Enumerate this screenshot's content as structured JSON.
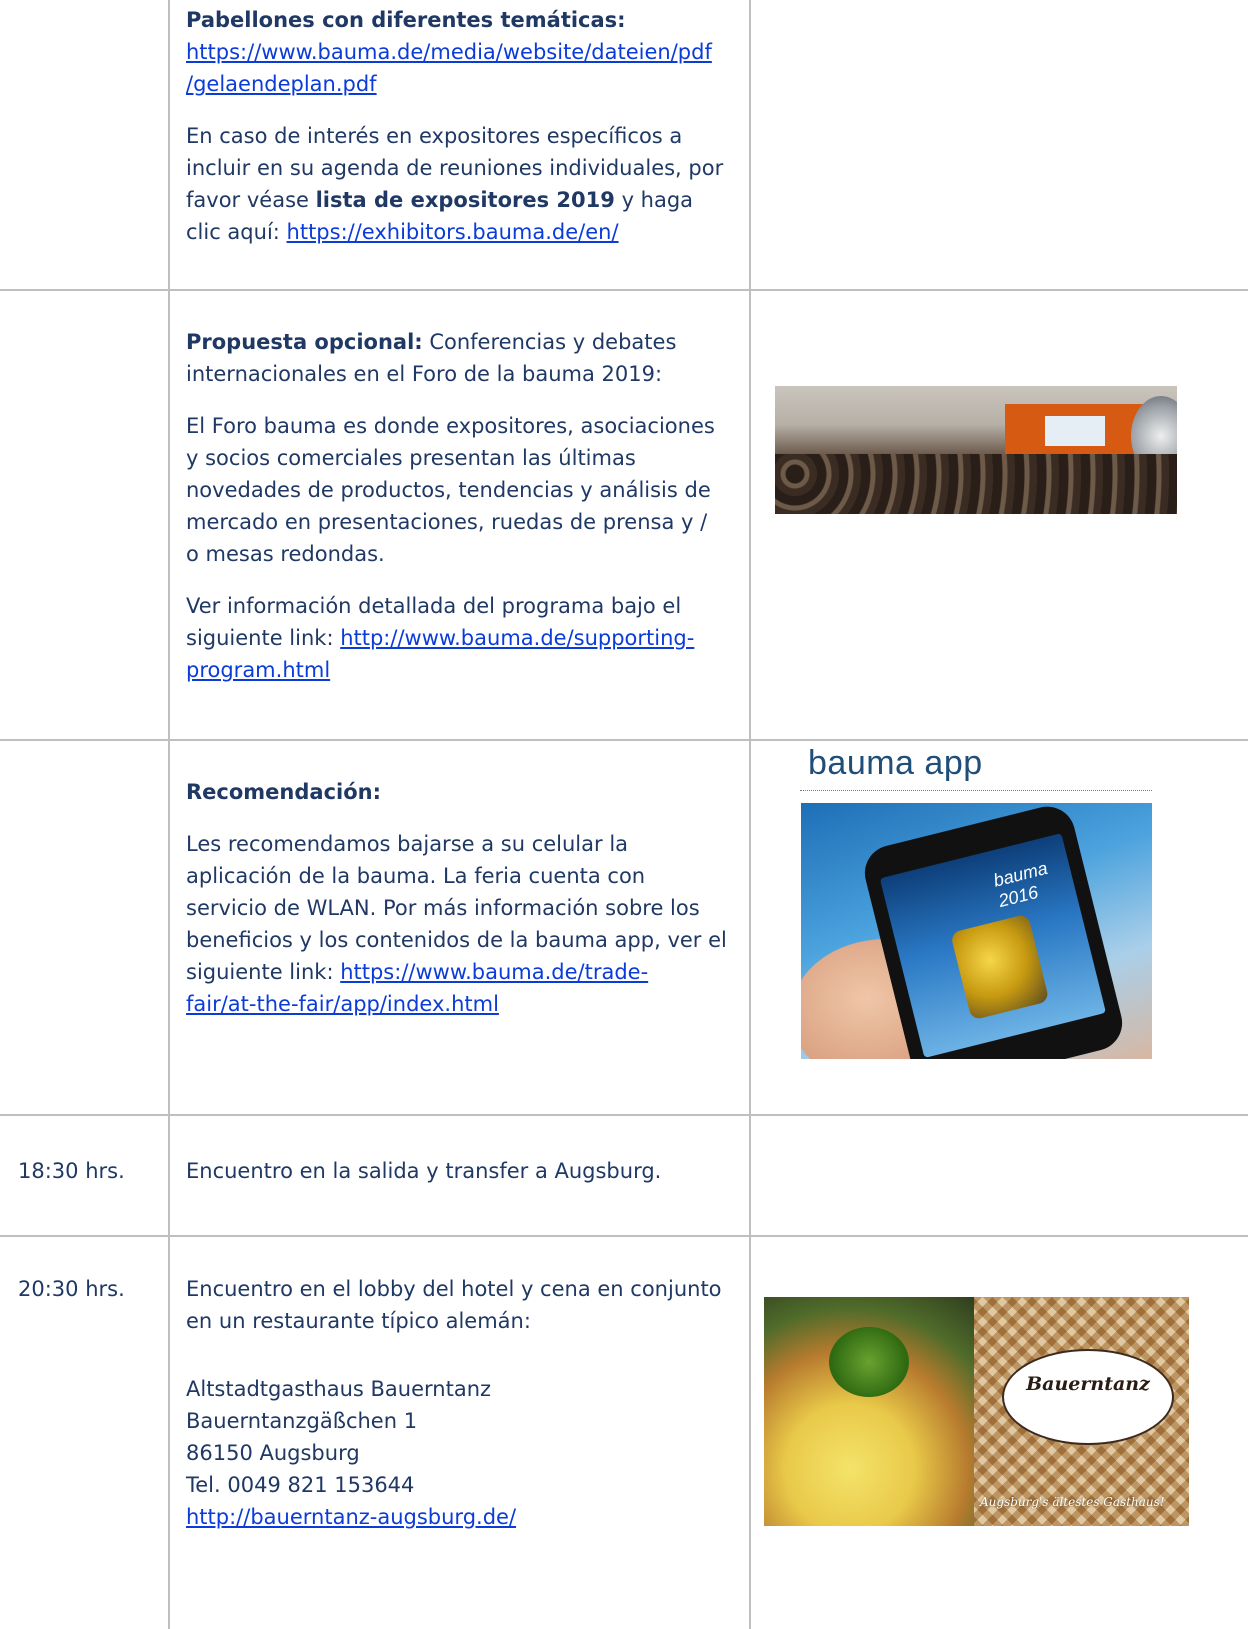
{
  "rows": {
    "row1": {
      "heading": "Pabellones con diferentes temáticas:",
      "plan_link_line1": "https://www.bauma.de/media/website/dateien/pdf",
      "plan_link_line2": "/gelaendeplan.pdf",
      "interest_l1": "En caso de interés en expositores específicos a",
      "interest_l2": "incluir en su agenda de reuniones individuales, por",
      "interest_l3_pre": "favor véase ",
      "interest_l3_bold": "lista de expositores 2019",
      "interest_l3_post": " y haga",
      "interest_l4_pre": "clic aquí: ",
      "exhibitors_link": "https://exhibitors.bauma.de/en/"
    },
    "row2": {
      "label": "Propuesta opcional:",
      "intro_l1_rest": " Conferencias y debates",
      "intro_l2": "internacionales en el Foro de la bauma 2019:",
      "desc_l1": "El Foro bauma es donde expositores, asociaciones",
      "desc_l2": "y socios comerciales presentan las últimas",
      "desc_l3": "novedades de productos, tendencias y análisis de",
      "desc_l4": "mercado en presentaciones, ruedas de prensa y /",
      "desc_l5": "o mesas redondas.",
      "program_l1": "Ver información detallada del programa bajo el",
      "program_l2_pre": "siguiente link: ",
      "program_link_l1": "http://www.bauma.de/supporting-",
      "program_link_l2": "program.html"
    },
    "row3": {
      "heading": "Recomendación:",
      "text_l1": "Les recomendamos bajarse a su celular la",
      "text_l2": "aplicación de la bauma. La feria cuenta con",
      "text_l3": "servicio de WLAN. Por más información sobre los",
      "text_l4": "beneficios y los contenidos de la bauma app, ver el",
      "text_l5_pre": "siguiente link: ",
      "app_link_l1": "https://www.bauma.de/trade-",
      "app_link_l2": "fair/at-the-fair/app/index.html",
      "app_title": "bauma app",
      "phone_logo": "bauma 2016"
    },
    "row4": {
      "time": "18:30 hrs.",
      "text": "Encuentro en la salida y transfer a Augsburg."
    },
    "row5": {
      "time": "20:30 hrs.",
      "text_l1": "Encuentro en el lobby del hotel y cena en conjunto",
      "text_l2": "en un restaurante típico alemán:",
      "addr_name": "Altstadtgasthaus Bauerntanz",
      "addr_street": "Bauerntanzgäßchen 1",
      "addr_city": "86150 Augsburg",
      "addr_tel": "Tel. 0049 821 153644",
      "restaurant_link": "http://bauerntanz-augsburg.de/",
      "logo_name": "Bauerntanz",
      "logo_tagline": "Augsburg's ältestes Gasthaus!"
    }
  },
  "colors": {
    "text": "#1f3864",
    "link": "#0b3bd8",
    "border": "#bfbfbf"
  }
}
